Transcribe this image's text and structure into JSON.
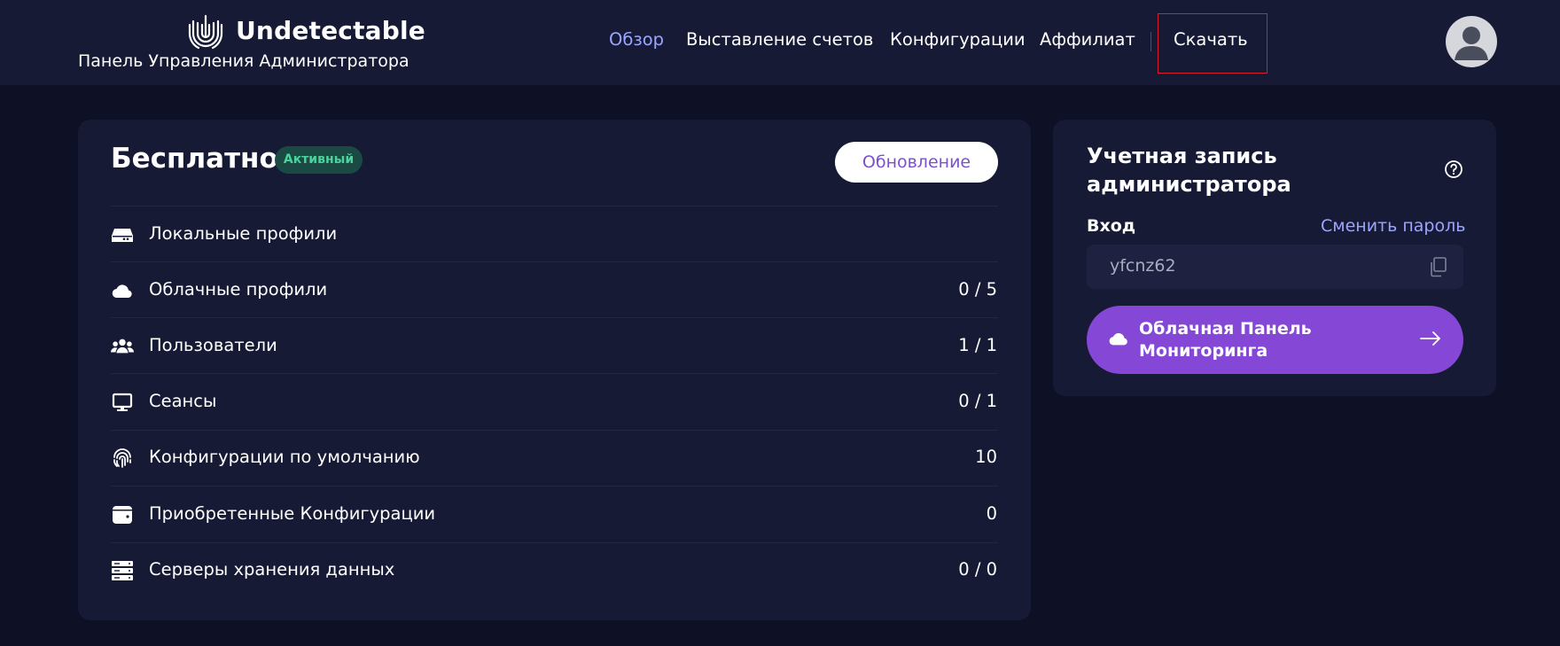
{
  "header": {
    "brand": "Undetectable",
    "subtitle": "Панель Управления Администратора",
    "nav": [
      "Обзор",
      "Выставление счетов",
      "Конфигурации",
      "Аффилиат",
      "Скачать"
    ]
  },
  "plan": {
    "title": "Бесплатно",
    "badge": "Активный",
    "upgrade_label": "Обновление",
    "rows": [
      {
        "label": "Локальные профили",
        "value": "",
        "icon": "drive-icon"
      },
      {
        "label": "Облачные профили",
        "value": "0 / 5",
        "icon": "cloud-icon"
      },
      {
        "label": "Пользователи",
        "value": "1 / 1",
        "icon": "users-icon"
      },
      {
        "label": "Сеансы",
        "value": "0 / 1",
        "icon": "monitor-icon"
      },
      {
        "label": "Конфигурации по умолчанию",
        "value": "10",
        "icon": "fingerprint-icon"
      },
      {
        "label": "Приобретенные Конфигурации",
        "value": "0",
        "icon": "wallet-icon"
      },
      {
        "label": "Серверы хранения данных",
        "value": "0 / 0",
        "icon": "server-icon"
      }
    ]
  },
  "account": {
    "title": "Учетная запись администратора",
    "login_label": "Вход",
    "change_password": "Сменить пароль",
    "login_value": "yfcnz62",
    "cloud_button": "Облачная Панель Мониторинга"
  },
  "colors": {
    "background": "#0e1026",
    "card": "#161a34",
    "accent_purple": "#8447d6",
    "link_blue": "#9aa6ff",
    "badge_green": "#4ad39a"
  }
}
